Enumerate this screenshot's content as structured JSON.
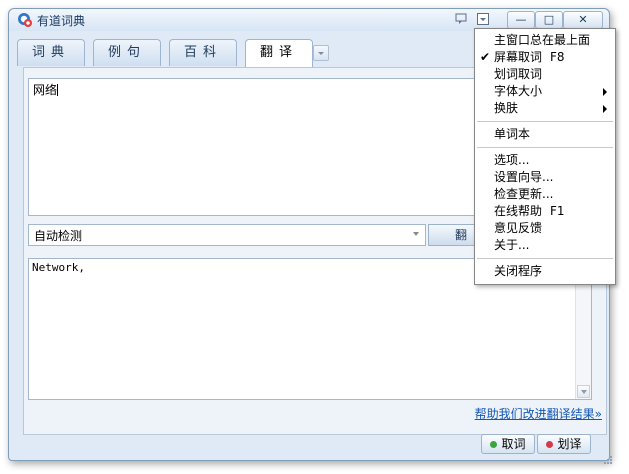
{
  "window": {
    "title": "有道词典",
    "minimize_label": "—",
    "maximize_label": "□",
    "close_label": "✕"
  },
  "tabs": [
    {
      "label": "词典"
    },
    {
      "label": "例句"
    },
    {
      "label": "百科"
    },
    {
      "label": "翻译",
      "active": true
    }
  ],
  "source": {
    "text": "网络"
  },
  "language_select": {
    "value": "自动检测"
  },
  "translate_button": {
    "label": "翻"
  },
  "output": {
    "text": "Network,"
  },
  "help_link": {
    "text": "帮助我们改进翻译结果»"
  },
  "bottom_buttons": {
    "pick_word": "取词",
    "select_translate": "划译"
  },
  "menu": {
    "items": [
      {
        "label": "主窗口总在最上面"
      },
      {
        "label": "屏幕取词",
        "shortcut": "F8",
        "checked": true
      },
      {
        "label": "划词取词"
      },
      {
        "label": "字体大小",
        "submenu": true
      },
      {
        "label": "换肤",
        "submenu": true
      },
      {
        "label": "单词本"
      },
      {
        "label": "选项..."
      },
      {
        "label": "设置向导..."
      },
      {
        "label": "检查更新..."
      },
      {
        "label": "在线帮助",
        "shortcut": "F1"
      },
      {
        "label": "意见反馈"
      },
      {
        "label": "关于..."
      },
      {
        "label": "关闭程序"
      }
    ],
    "check_mark": "✔"
  },
  "colors": {
    "accent": "#1457b4",
    "pick_word_dot": "#3aa63a",
    "select_translate_dot": "#d63a4a"
  }
}
